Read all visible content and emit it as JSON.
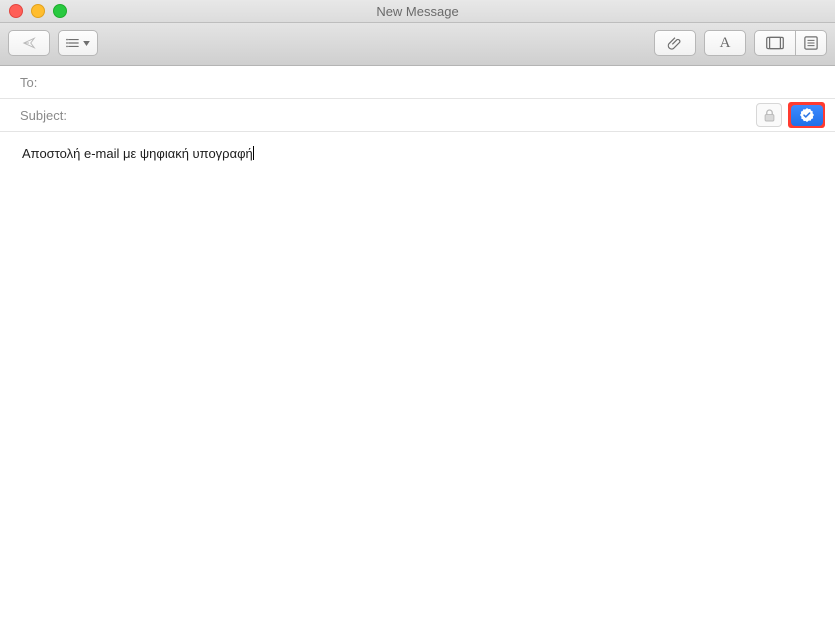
{
  "window": {
    "title": "New Message"
  },
  "fields": {
    "to_label": "To:",
    "to_value": "",
    "subject_label": "Subject:",
    "subject_value": ""
  },
  "body": {
    "text": "Αποστολή e-mail με ψηφιακή υπογραφή"
  },
  "icons": {
    "send": "send-icon",
    "header_menu": "header-fields-menu-icon",
    "attach": "paperclip-icon",
    "format": "format-text-icon",
    "photo": "photo-browser-icon",
    "template": "stationery-icon",
    "lock": "lock-icon",
    "sign": "sign-badge-icon"
  }
}
